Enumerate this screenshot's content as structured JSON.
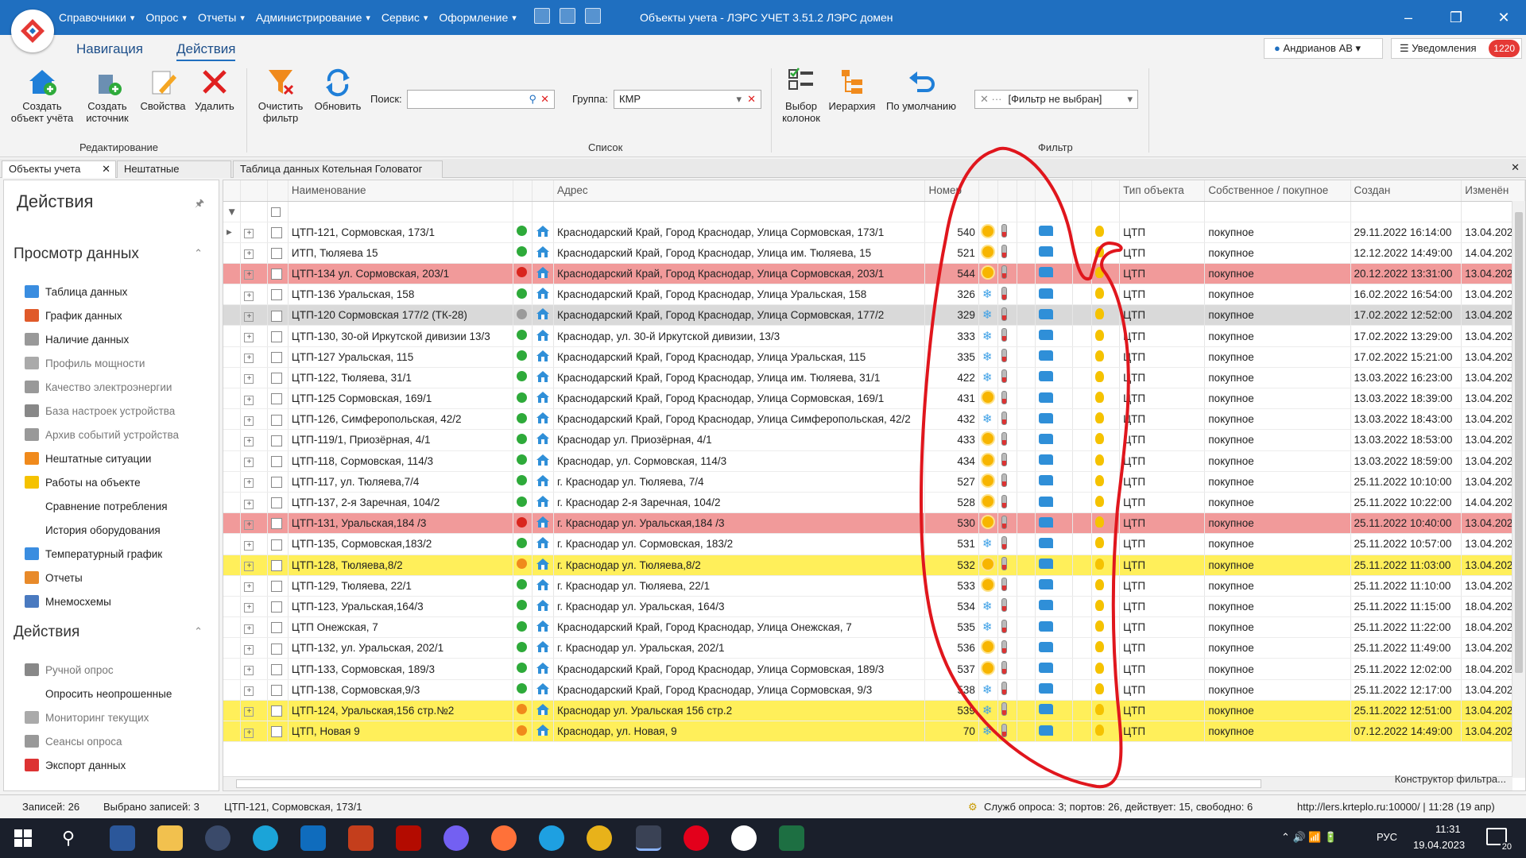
{
  "menu": [
    "Справочники",
    "Опрос",
    "Отчеты",
    "Администрирование",
    "Сервис",
    "Оформление"
  ],
  "window_title": "Объекты учета - ЛЭРС УЧЕТ 3.51.2 ЛЭРС домен",
  "ribbon_tabs": {
    "nav": "Навигация",
    "actions": "Действия"
  },
  "user": "Андрианов АВ",
  "notifications": {
    "label": "Уведомления",
    "count": "1220"
  },
  "ribbon": {
    "create_object": "Создать\nобъект учёта",
    "create_source": "Создать\nисточник",
    "properties": "Свойства",
    "delete": "Удалить",
    "clear_filter": "Очистить\nфильтр",
    "refresh": "Обновить",
    "search_label": "Поиск:",
    "group_label": "Группа:",
    "group_value": "КМР",
    "columns": "Выбор\nколонок",
    "hierarchy": "Иерархия",
    "default": "По умолчанию",
    "filter_value": "[Фильтр не выбран]",
    "group_edit": "Редактирование",
    "group_list": "Список",
    "group_filter": "Фильтр"
  },
  "doc_tabs": [
    "Объекты учета",
    "Нештатные ситуации",
    "Таблица данных Котельная Головатог"
  ],
  "sidebar": {
    "title": "Действия",
    "section1": "Просмотр данных",
    "items1": [
      "Таблица данных",
      "График данных",
      "Наличие данных",
      "Профиль мощности",
      "Качество электроэнергии",
      "База настроек устройства",
      "Архив событий устройства",
      "Нештатные ситуации",
      "Работы на объекте",
      "Сравнение потребления",
      "История оборудования",
      "Температурный график",
      "Отчеты",
      "Мнемосхемы"
    ],
    "section2": "Действия",
    "items2": [
      "Ручной опрос",
      "Опросить неопрошенные",
      "Мониторинг текущих",
      "Сеансы опроса",
      "Экспорт данных"
    ]
  },
  "columns": {
    "name": "Наименование",
    "address": "Адрес",
    "number": "Номер",
    "type": "Тип объекта",
    "own": "Собственное / покупное",
    "created": "Создан",
    "changed": "Изменён"
  },
  "rows": [
    {
      "name": "ЦТП-121, Сормовская, 173/1",
      "addr": "Краснодарский Край, Город Краснодар, Улица Сормовская, 173/1",
      "num": "540",
      "dot": "#2eaa3a",
      "season": "sun",
      "type": "ЦТП",
      "own": "покупное",
      "created": "29.11.2022 16:14:00",
      "changed": "13.04.202",
      "style": ""
    },
    {
      "name": "ИТП, Тюляева 15",
      "addr": "Краснодарский Край, Город Краснодар, Улица им. Тюляева, 15",
      "num": "521",
      "dot": "#2eaa3a",
      "season": "sun",
      "type": "ЦТП",
      "own": "покупное",
      "created": "12.12.2022 14:49:00",
      "changed": "14.04.202",
      "style": ""
    },
    {
      "name": "ЦТП-134 ул. Сормовская, 203/1",
      "addr": "Краснодарский Край, Город Краснодар, Улица Сормовская, 203/1",
      "num": "544",
      "dot": "#d9251d",
      "season": "sun",
      "type": "ЦТП",
      "own": "покупное",
      "created": "20.12.2022 13:31:00",
      "changed": "13.04.202",
      "style": "red"
    },
    {
      "name": "ЦТП-136 Уральская, 158",
      "addr": "Краснодарский Край, Город Краснодар, Улица Уральская, 158",
      "num": "326",
      "dot": "#2eaa3a",
      "season": "snow",
      "type": "ЦТП",
      "own": "покупное",
      "created": "16.02.2022 16:54:00",
      "changed": "13.04.202",
      "style": ""
    },
    {
      "name": "ЦТП-120 Сормовская 177/2 (ТК-28)",
      "addr": "Краснодарский Край, Город Краснодар, Улица Сормовская, 177/2",
      "num": "329",
      "dot": "#9a9a9a",
      "season": "snow",
      "type": "ЦТП",
      "own": "покупное",
      "created": "17.02.2022 12:52:00",
      "changed": "13.04.202",
      "style": "grey"
    },
    {
      "name": "ЦТП-130, 30-ой Иркутской дивизии 13/3",
      "addr": "Краснодар, ул. 30-й Иркутской дивизии, 13/3",
      "num": "333",
      "dot": "#2eaa3a",
      "season": "snow",
      "type": "ЦТП",
      "own": "покупное",
      "created": "17.02.2022 13:29:00",
      "changed": "13.04.202",
      "style": ""
    },
    {
      "name": "ЦТП-127 Уральская, 115",
      "addr": "Краснодарский Край, Город Краснодар, Улица Уральская, 115",
      "num": "335",
      "dot": "#2eaa3a",
      "season": "snow",
      "type": "ЦТП",
      "own": "покупное",
      "created": "17.02.2022 15:21:00",
      "changed": "13.04.202",
      "style": ""
    },
    {
      "name": "ЦТП-122, Тюляева, 31/1",
      "addr": "Краснодарский Край, Город Краснодар, Улица им. Тюляева, 31/1",
      "num": "422",
      "dot": "#2eaa3a",
      "season": "snow",
      "type": "ЦТП",
      "own": "покупное",
      "created": "13.03.2022 16:23:00",
      "changed": "13.04.202",
      "style": ""
    },
    {
      "name": "ЦТП-125 Сормовская, 169/1",
      "addr": "Краснодарский Край, Город Краснодар, Улица Сормовская, 169/1",
      "num": "431",
      "dot": "#2eaa3a",
      "season": "sun",
      "type": "ЦТП",
      "own": "покупное",
      "created": "13.03.2022 18:39:00",
      "changed": "13.04.202",
      "style": ""
    },
    {
      "name": "ЦТП-126, Симферопольская, 42/2",
      "addr": "Краснодарский Край, Город Краснодар, Улица Симферопольская, 42/2",
      "num": "432",
      "dot": "#2eaa3a",
      "season": "snow",
      "type": "ЦТП",
      "own": "покупное",
      "created": "13.03.2022 18:43:00",
      "changed": "13.04.202",
      "style": ""
    },
    {
      "name": "ЦТП-119/1, Приозёрная, 4/1",
      "addr": "Краснодар ул. Приозёрная, 4/1",
      "num": "433",
      "dot": "#2eaa3a",
      "season": "sun",
      "type": "ЦТП",
      "own": "покупное",
      "created": "13.03.2022 18:53:00",
      "changed": "13.04.202",
      "style": ""
    },
    {
      "name": "ЦТП-118, Сормовская, 114/3",
      "addr": "Краснодар, ул. Сормовская, 114/3",
      "num": "434",
      "dot": "#2eaa3a",
      "season": "sun",
      "type": "ЦТП",
      "own": "покупное",
      "created": "13.03.2022 18:59:00",
      "changed": "13.04.202",
      "style": ""
    },
    {
      "name": "ЦТП-117, ул. Тюляева,7/4",
      "addr": "г. Краснодар ул. Тюляева, 7/4",
      "num": "527",
      "dot": "#2eaa3a",
      "season": "sun",
      "type": "ЦТП",
      "own": "покупное",
      "created": "25.11.2022 10:10:00",
      "changed": "13.04.202",
      "style": ""
    },
    {
      "name": "ЦТП-137, 2-я Заречная, 104/2",
      "addr": "г. Краснодар 2-я Заречная, 104/2",
      "num": "528",
      "dot": "#2eaa3a",
      "season": "sun",
      "type": "ЦТП",
      "own": "покупное",
      "created": "25.11.2022 10:22:00",
      "changed": "14.04.202",
      "style": ""
    },
    {
      "name": "ЦТП-131, Уральская,184 /3",
      "addr": "г. Краснодар ул. Уральская,184 /3",
      "num": "530",
      "dot": "#d9251d",
      "season": "sun",
      "type": "ЦТП",
      "own": "покупное",
      "created": "25.11.2022 10:40:00",
      "changed": "13.04.202",
      "style": "red"
    },
    {
      "name": "ЦТП-135, Сормовская,183/2",
      "addr": "г. Краснодар ул. Сормовская, 183/2",
      "num": "531",
      "dot": "#2eaa3a",
      "season": "snow",
      "type": "ЦТП",
      "own": "покупное",
      "created": "25.11.2022 10:57:00",
      "changed": "13.04.202",
      "style": ""
    },
    {
      "name": "ЦТП-128, Тюляева,8/2",
      "addr": "г. Краснодар ул. Тюляева,8/2",
      "num": "532",
      "dot": "#f08a1c",
      "season": "sun",
      "type": "ЦТП",
      "own": "покупное",
      "created": "25.11.2022 11:03:00",
      "changed": "13.04.202",
      "style": "yellow"
    },
    {
      "name": "ЦТП-129, Тюляева, 22/1",
      "addr": "г. Краснодар ул. Тюляева, 22/1",
      "num": "533",
      "dot": "#2eaa3a",
      "season": "sun",
      "type": "ЦТП",
      "own": "покупное",
      "created": "25.11.2022 11:10:00",
      "changed": "13.04.202",
      "style": ""
    },
    {
      "name": "ЦТП-123, Уральская,164/3",
      "addr": "г. Краснодар ул. Уральская, 164/3",
      "num": "534",
      "dot": "#2eaa3a",
      "season": "snow",
      "type": "ЦТП",
      "own": "покупное",
      "created": "25.11.2022 11:15:00",
      "changed": "18.04.202",
      "style": ""
    },
    {
      "name": "ЦТП Онежская, 7",
      "addr": "Краснодарский Край, Город Краснодар, Улица Онежская, 7",
      "num": "535",
      "dot": "#2eaa3a",
      "season": "snow",
      "type": "ЦТП",
      "own": "покупное",
      "created": "25.11.2022 11:22:00",
      "changed": "18.04.202",
      "style": ""
    },
    {
      "name": "ЦТП-132, ул. Уральская, 202/1",
      "addr": "г. Краснодар ул. Уральская, 202/1",
      "num": "536",
      "dot": "#2eaa3a",
      "season": "sun",
      "type": "ЦТП",
      "own": "покупное",
      "created": "25.11.2022 11:49:00",
      "changed": "13.04.202",
      "style": ""
    },
    {
      "name": "ЦТП-133, Сормовская, 189/3",
      "addr": "Краснодарский Край, Город Краснодар, Улица Сормовская, 189/3",
      "num": "537",
      "dot": "#2eaa3a",
      "season": "sun",
      "type": "ЦТП",
      "own": "покупное",
      "created": "25.11.2022 12:02:00",
      "changed": "18.04.202",
      "style": ""
    },
    {
      "name": "ЦТП-138, Сормовская,9/3",
      "addr": "Краснодарский Край, Город Краснодар, Улица Сормовская, 9/3",
      "num": "538",
      "dot": "#2eaa3a",
      "season": "snow",
      "type": "ЦТП",
      "own": "покупное",
      "created": "25.11.2022 12:17:00",
      "changed": "13.04.202",
      "style": ""
    },
    {
      "name": "ЦТП-124, Уральская,156 стр.№2",
      "addr": "Краснодар ул. Уральская 156 стр.2",
      "num": "539",
      "dot": "#f08a1c",
      "season": "snow",
      "type": "ЦТП",
      "own": "покупное",
      "created": "25.11.2022 12:51:00",
      "changed": "13.04.202",
      "style": "yellow"
    },
    {
      "name": "ЦТП, Новая 9",
      "addr": "Краснодар, ул. Новая, 9",
      "num": "70",
      "dot": "#f08a1c",
      "season": "snow",
      "type": "ЦТП",
      "own": "покупное",
      "created": "07.12.2022 14:49:00",
      "changed": "13.04.202",
      "style": "yellow"
    }
  ],
  "konstruktor": "Конструктор фильтра...",
  "status": {
    "records": "Записей: 26",
    "selected": "Выбрано записей: 3",
    "current": "ЦТП-121, Сормовская, 173/1",
    "services": "Служб опроса: 3; портов: 26, действует: 15, свободно: 6",
    "url": "http://lers.krteplo.ru:10000/ | 11:28 (19 апр)"
  },
  "tray": {
    "lang": "РУС",
    "time": "11:31",
    "date": "19.04.2023",
    "notif_count": "20"
  },
  "colors": {
    "titlebar": "#1f6fc0",
    "red_row": "#f19a9a",
    "yellow_row": "#ffef5a",
    "annotation": "#e0161d"
  }
}
